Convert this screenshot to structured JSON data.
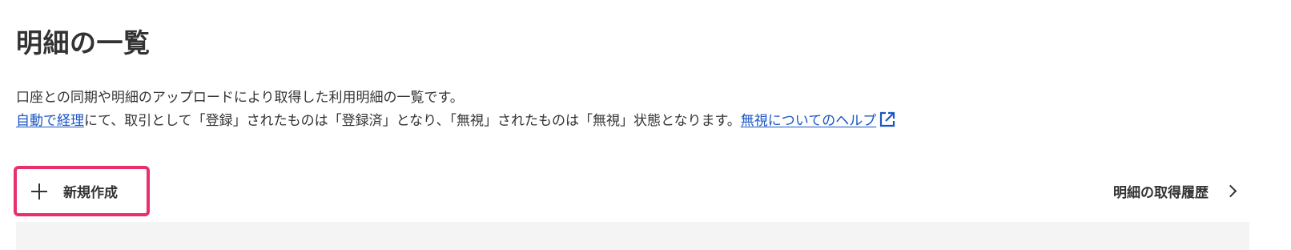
{
  "page": {
    "title": "明細の一覧"
  },
  "description": {
    "line1": "口座との同期や明細のアップロードにより取得した利用明細の一覧です。",
    "auto_link": "自動で経理",
    "line2_text": "にて、取引として「登録」されたものは「登録済」となり、「無視」されたものは「無視」状態となります。",
    "help_link": "無視についてのヘルプ",
    "help_icon": "external-link-icon",
    "link_color": "#1a56c4"
  },
  "toolbar": {
    "new_button_label": "新規作成",
    "new_button_icon": "plus-icon",
    "new_button_highlight_color": "#e8306a",
    "history_label": "明細の取得履歴",
    "history_icon": "chevron-right-icon"
  }
}
